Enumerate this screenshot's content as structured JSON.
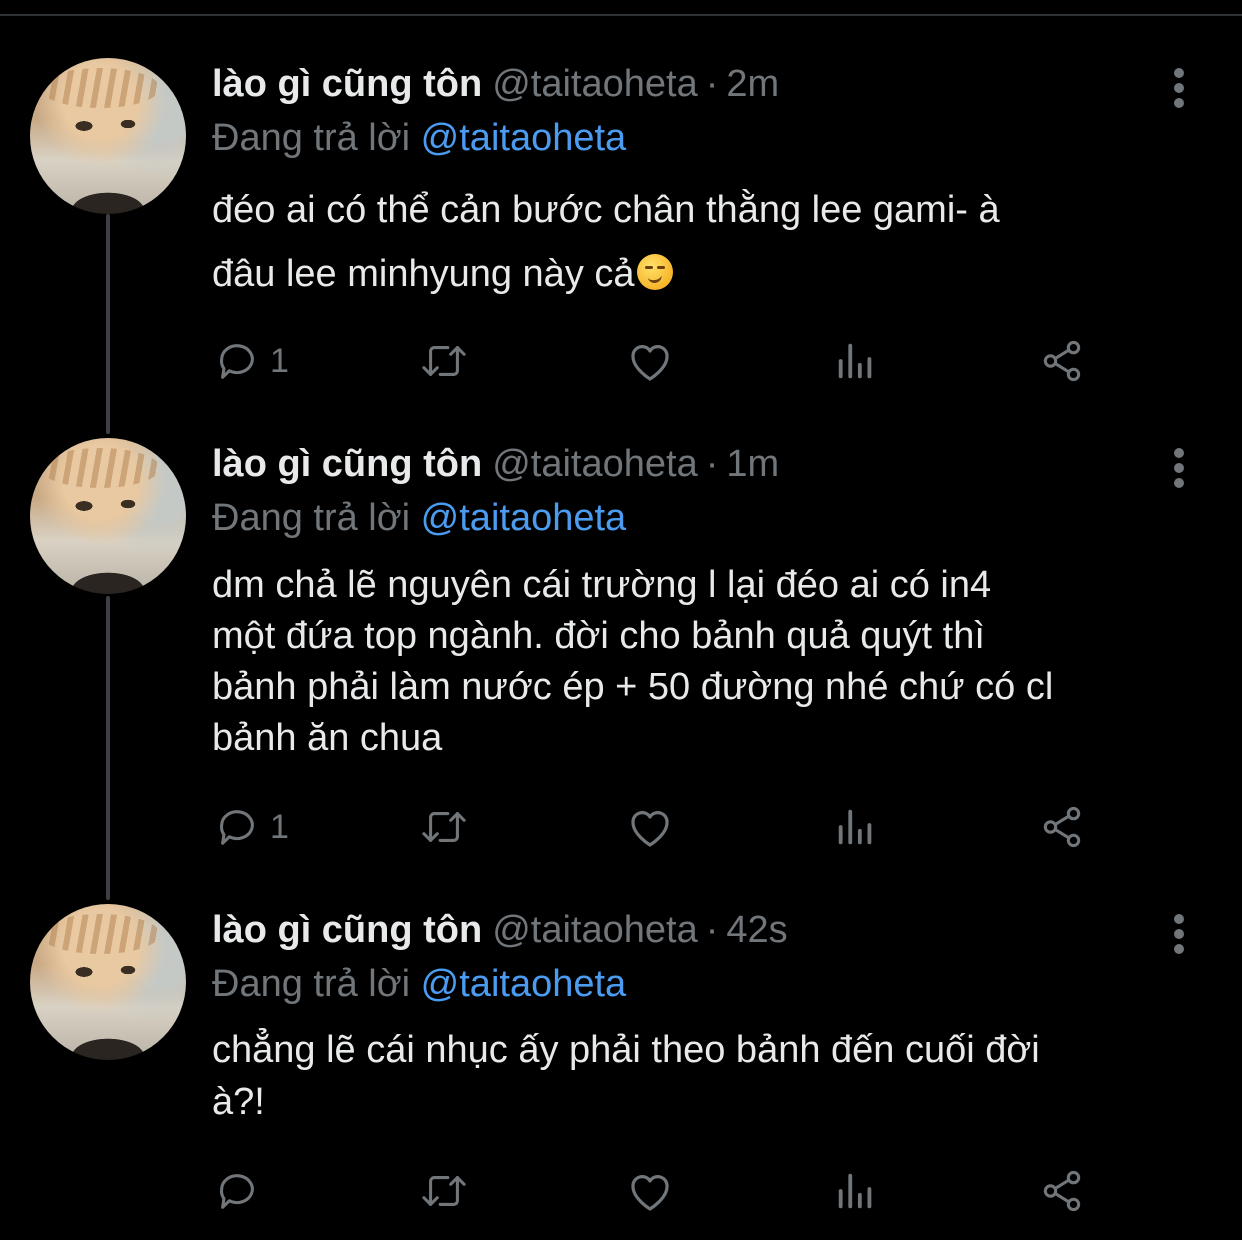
{
  "tweets": [
    {
      "name": "lào gì cũng tôn",
      "handle": "@taitaoheta",
      "separator": "·",
      "time": "2m",
      "reply_prefix": "Đang trả lời",
      "reply_mention": "@taitaoheta",
      "lines": [
        "đéo ai có thể cản bước chân thằng lee gami- à",
        "đâu lee minhyung này cả"
      ],
      "emoji": "smirking-face",
      "reply_count": "1",
      "retweet_count": "",
      "like_count": ""
    },
    {
      "name": "lào gì cũng tôn",
      "handle": "@taitaoheta",
      "separator": "·",
      "time": "1m",
      "reply_prefix": "Đang trả lời",
      "reply_mention": "@taitaoheta",
      "lines": [
        "dm chả lẽ nguyên cái trường l lại đéo ai có in4",
        "một đứa top ngành. đời cho bảnh quả quýt thì",
        "bảnh phải làm nước ép + 50 đường nhé chứ có cl",
        "bảnh ăn chua"
      ],
      "reply_count": "1",
      "retweet_count": "",
      "like_count": ""
    },
    {
      "name": "lào gì cũng tôn",
      "handle": "@taitaoheta",
      "separator": "·",
      "time": "42s",
      "reply_prefix": "Đang trả lời",
      "reply_mention": "@taitaoheta",
      "lines": [
        "chẳng lẽ cái nhục ấy phải theo bảnh đến cuối đời",
        "à?!"
      ],
      "reply_count": "",
      "retweet_count": "",
      "like_count": ""
    }
  ],
  "icons": {
    "reply": "reply-icon",
    "retweet": "retweet-icon",
    "like": "heart-icon",
    "analytics": "analytics-icon",
    "share": "share-icon",
    "more": "more-vertical-icon"
  },
  "colors": {
    "background": "#000000",
    "text": "#e7e9ea",
    "muted": "#71767b",
    "mention": "#4b9cf0",
    "thread_line": "#3d4145"
  }
}
